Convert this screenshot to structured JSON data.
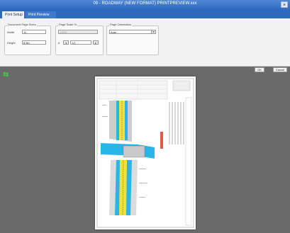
{
  "window": {
    "title": "09 - ROADWAY (NEW FORMAT) PRINTPREVIEW.xxx",
    "close_glyph": "×"
  },
  "tabs": [
    {
      "label": "Print Setup"
    },
    {
      "label": "Print Preview"
    }
  ],
  "settings": {
    "paper_group": {
      "title": "Document Page Sizes",
      "width_label": "Width",
      "width_value": "11",
      "height_label": "Height",
      "height_value": "8.5in"
    },
    "scale_group": {
      "title": "Page Scale %",
      "scale_value": "100%",
      "copies_label": "#",
      "copies_value": "1/1"
    },
    "orientation_group": {
      "title": "Page Orientation",
      "value": "Auto"
    }
  },
  "buttons": {
    "ok": "OK",
    "cancel": "Cancel"
  },
  "nav_arrows": "⇆",
  "colors": {
    "titlebar": "#2f68bd",
    "workspace": "#6a6a6a",
    "road_yellow": "#f0e03a",
    "water_blue": "#28b6e8"
  }
}
